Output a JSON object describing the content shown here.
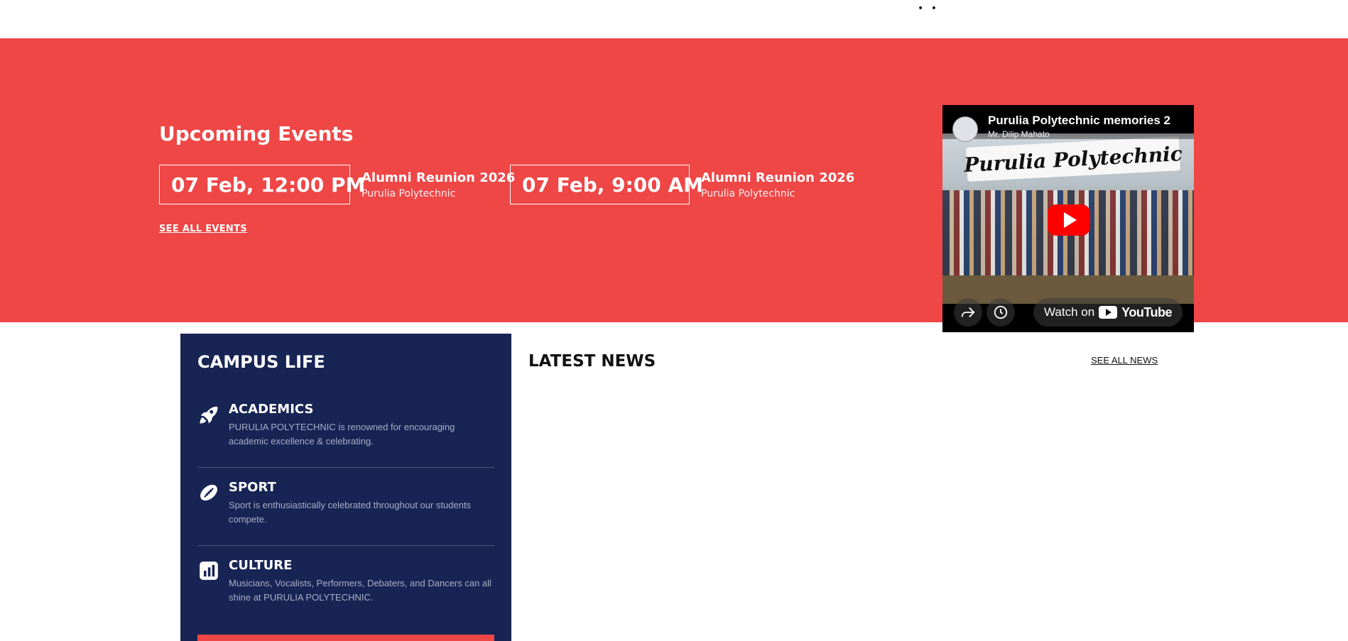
{
  "topbar": {
    "dots": "• •"
  },
  "events": {
    "title": "Upcoming Events",
    "items": [
      {
        "date": "07 Feb, 12:00 PM",
        "name": "Alumni Reunion 2026",
        "place": "Purulia Polytechnic"
      },
      {
        "date": "07 Feb, 9:00 AM",
        "name": "Alumni Reunion 2026",
        "place": "Purulia Polytechnic"
      }
    ],
    "see_all": "SEE ALL EVENTS",
    "accent_color": "#ef4646"
  },
  "video": {
    "title": "Purulia Polytechnic memories 2",
    "channel": "Mr. Dilip Mahato",
    "thumbnail_banner": "Purulia Polytechnic",
    "watch_on": "Watch on",
    "youtube_word": "YouTube",
    "icons": [
      "play-icon",
      "share-icon",
      "clock-icon",
      "youtube-logo-icon"
    ]
  },
  "campus_life": {
    "title": "CAMPUS LIFE",
    "background_color": "#182454",
    "items": [
      {
        "icon": "rocket-icon",
        "title": "ACADEMICS",
        "desc": "PURULIA POLYTECHNIC is renowned for encouraging academic excellence & celebrating."
      },
      {
        "icon": "rugby-ball-icon",
        "title": "SPORT",
        "desc": "Sport is enthusiastically celebrated throughout our students compete."
      },
      {
        "icon": "bar-chart-icon",
        "title": "CULTURE",
        "desc": "Musicians, Vocalists, Performers, Debaters, and Dancers can all shine at PURULIA POLYTECHNIC."
      }
    ]
  },
  "news": {
    "title": "LATEST NEWS",
    "see_all": "SEE ALL NEWS"
  }
}
